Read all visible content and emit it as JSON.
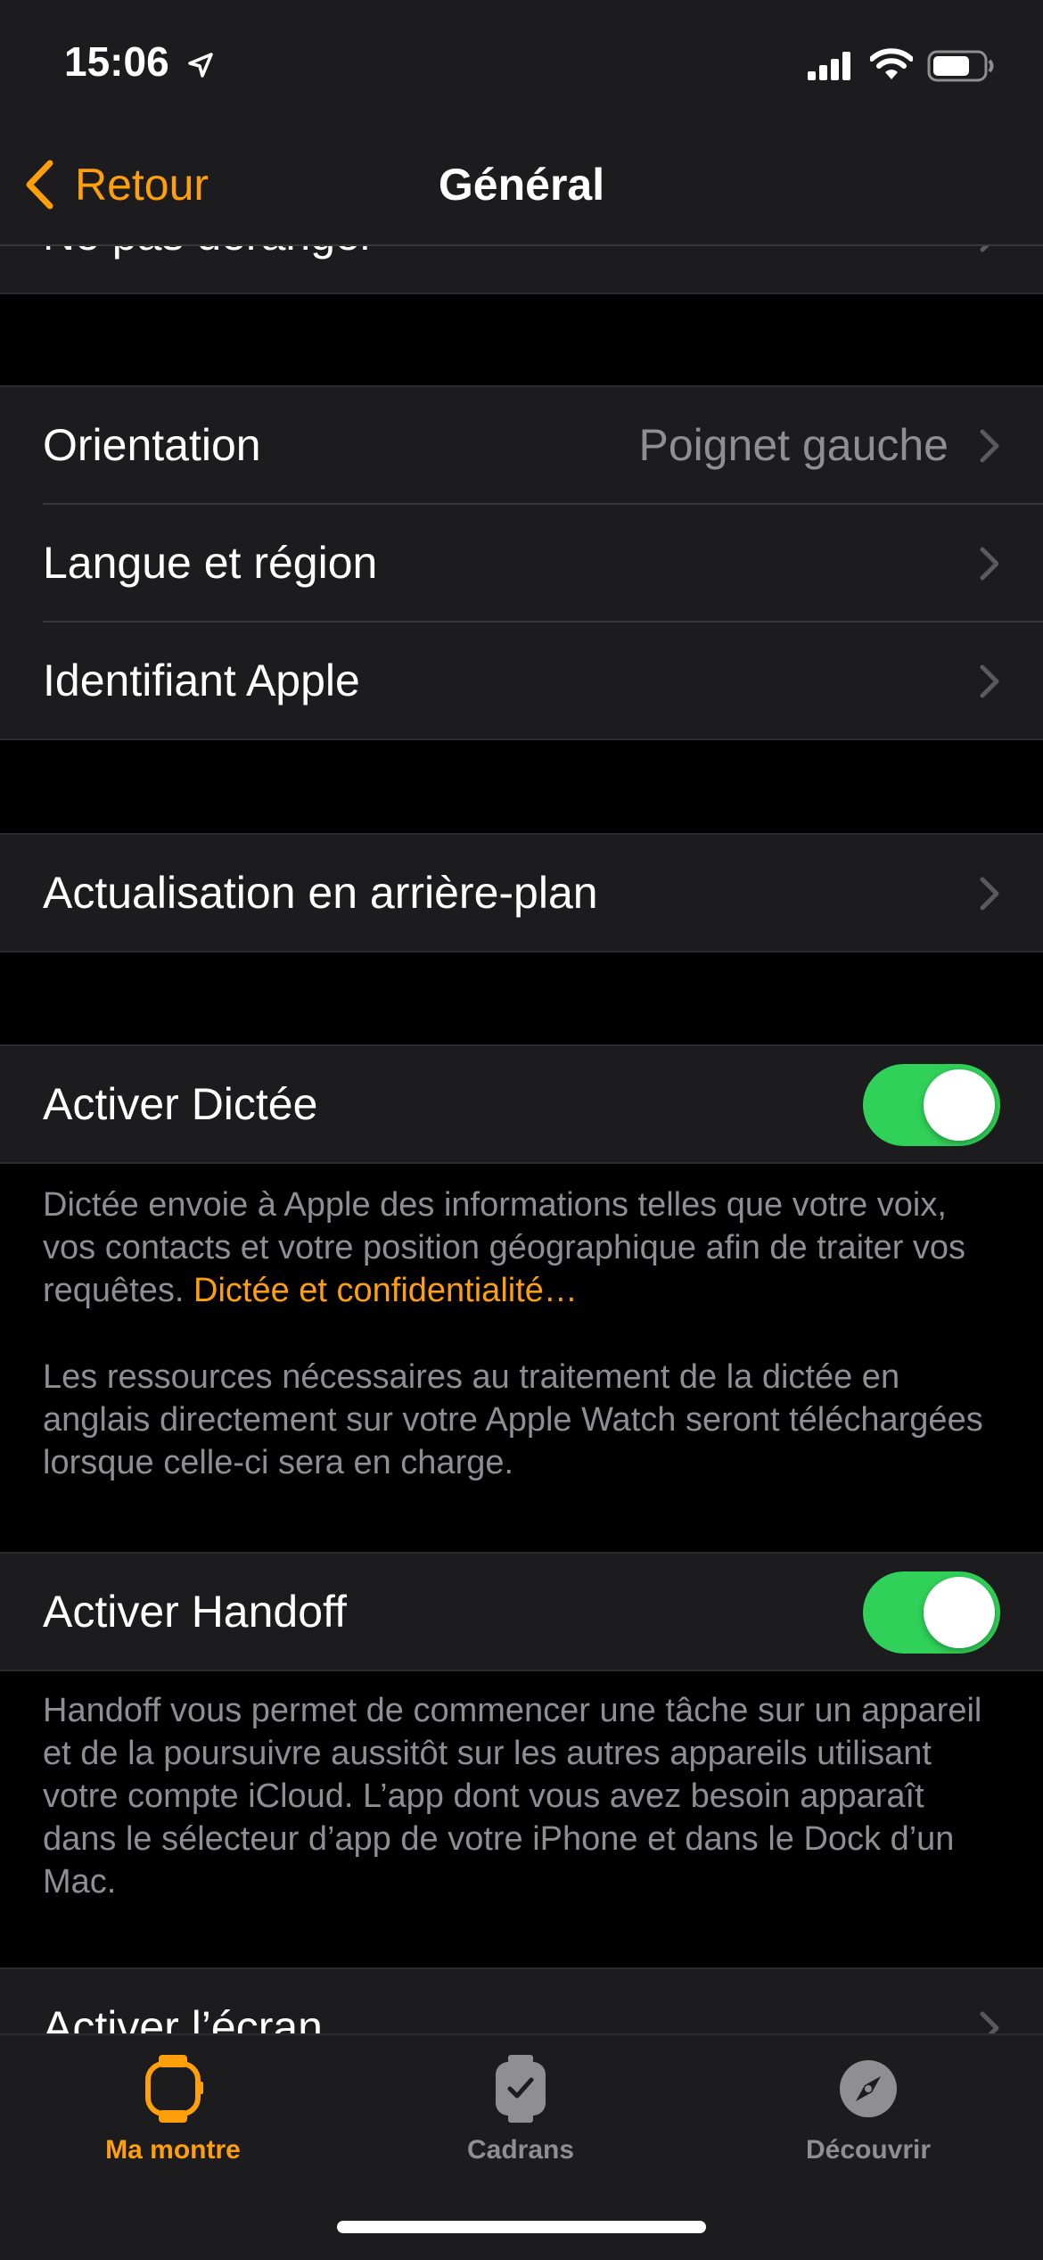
{
  "status_bar": {
    "time": "15:06"
  },
  "nav": {
    "back_label": "Retour",
    "title": "Général"
  },
  "sections": {
    "partial_top": {
      "label": "Ne pas déranger"
    },
    "group1": {
      "orientation_label": "Orientation",
      "orientation_value": "Poignet gauche",
      "language_label": "Langue et région",
      "apple_id_label": "Identifiant Apple"
    },
    "group2": {
      "background_refresh_label": "Actualisation en arrière-plan"
    },
    "dictation": {
      "label": "Activer Dictée",
      "enabled": true,
      "footer_text": "Dictée envoie à Apple des informations telles que votre voix, vos contacts et votre position géographique afin de traiter vos requêtes. ",
      "footer_link": "Dictée et confidentialité…",
      "footer_text2": "Les ressources nécessaires au traitement de la dictée en anglais directement sur votre Apple Watch seront téléchargées lorsque celle-ci sera en charge."
    },
    "handoff": {
      "label": "Activer Handoff",
      "enabled": true,
      "footer_text": "Handoff vous permet de commencer une tâche sur un appareil et de la poursuivre aussitôt sur les autres appareils utilisant votre compte iCloud. L’app dont vous avez besoin apparaît dans le sélecteur d’app de votre iPhone et dans le Dock d’un Mac."
    },
    "partial_bottom": {
      "label": "Activer l’écran"
    }
  },
  "tab_bar": {
    "tabs": [
      {
        "label": "Ma montre",
        "icon": "watch-icon",
        "active": true
      },
      {
        "label": "Cadrans",
        "icon": "watch-faces-icon",
        "active": false
      },
      {
        "label": "Découvrir",
        "icon": "compass-icon",
        "active": false
      }
    ]
  },
  "colors": {
    "accent": "#ff9f0a",
    "toggle_on": "#30d158",
    "cell_background": "#1c1c1e",
    "secondary_text": "#8e8e93"
  }
}
